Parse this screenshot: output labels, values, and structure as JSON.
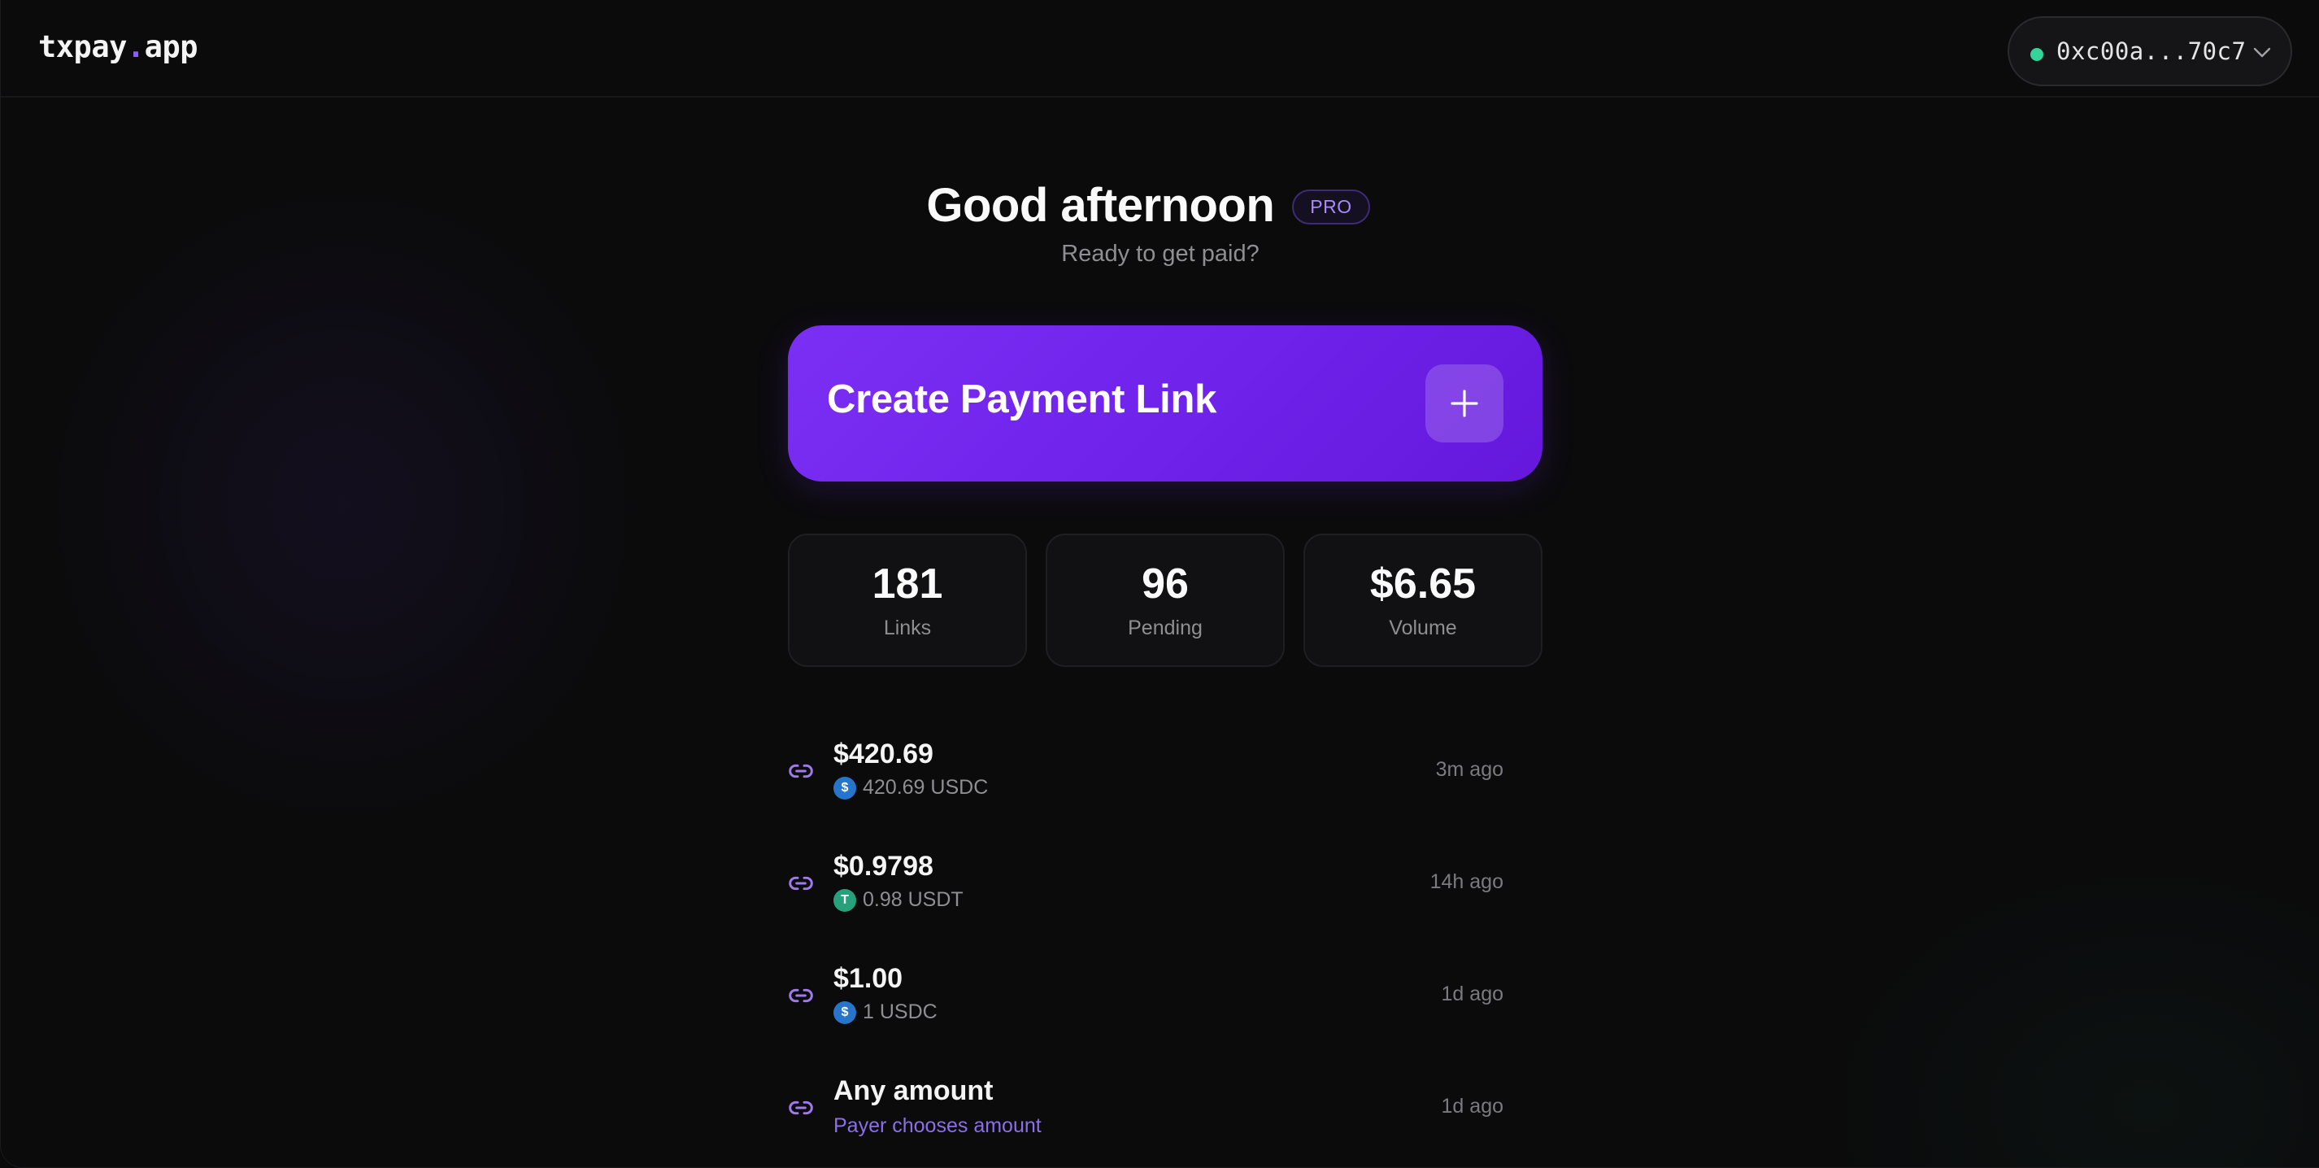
{
  "header": {
    "logo_main": "txpay",
    "logo_dot": ".",
    "logo_suffix": "app",
    "wallet_address": "0xc00a...70c7"
  },
  "greeting": {
    "title": "Good afternoon",
    "badge": "PRO",
    "subtitle": "Ready to get paid?"
  },
  "create_button": {
    "label": "Create Payment Link"
  },
  "stats": [
    {
      "value": "181",
      "label": "Links"
    },
    {
      "value": "96",
      "label": "Pending"
    },
    {
      "value": "$6.65",
      "label": "Volume"
    }
  ],
  "activity": [
    {
      "amount": "$420.69",
      "token_text": "420.69 USDC",
      "token_icon": "usdc-icon",
      "token_glyph": "$",
      "time": "3m ago"
    },
    {
      "amount": "$0.9798",
      "token_text": "0.98 USDT",
      "token_icon": "usdt-icon",
      "token_glyph": "T",
      "time": "14h ago"
    },
    {
      "amount": "$1.00",
      "token_text": "1 USDC",
      "token_icon": "usdc-icon",
      "token_glyph": "$",
      "time": "1d ago"
    },
    {
      "amount": "Any amount",
      "note": "Payer chooses amount",
      "time": "1d ago"
    }
  ],
  "colors": {
    "accent": "#7c2ff4",
    "status_online": "#34d399",
    "usdc": "#2775ca",
    "usdt": "#26a17b"
  }
}
